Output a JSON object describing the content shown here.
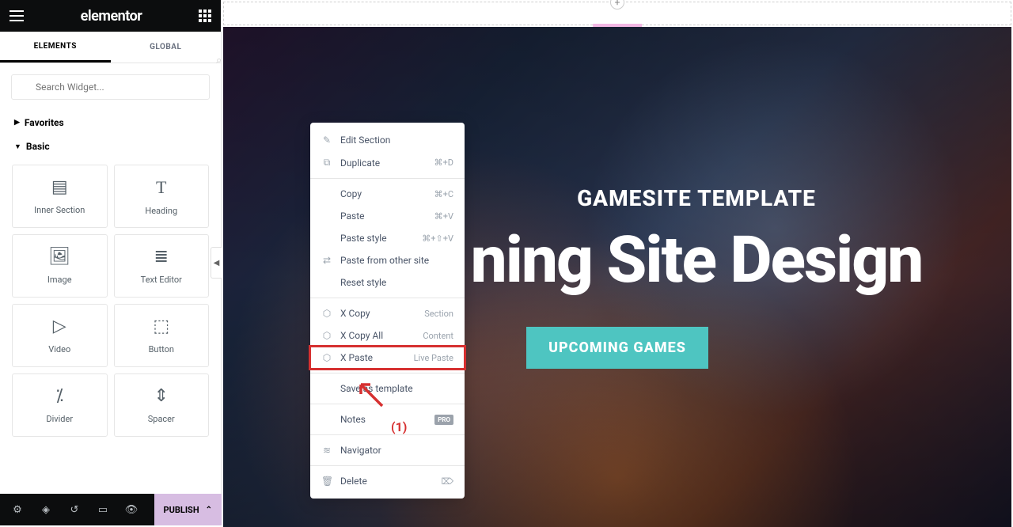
{
  "header": {
    "logo": "elementor"
  },
  "tabs": {
    "elements": "ELEMENTS",
    "global": "GLOBAL"
  },
  "search": {
    "placeholder": "Search Widget..."
  },
  "categories": {
    "favorites": "Favorites",
    "basic": "Basic"
  },
  "widgets": {
    "inner_section": "Inner Section",
    "heading": "Heading",
    "image": "Image",
    "text_editor": "Text Editor",
    "video": "Video",
    "button": "Button",
    "divider": "Divider",
    "spacer": "Spacer"
  },
  "footer": {
    "publish": "PUBLISH"
  },
  "context_menu": {
    "edit_section": "Edit Section",
    "duplicate": {
      "label": "Duplicate",
      "shortcut": "⌘+D"
    },
    "copy": {
      "label": "Copy",
      "shortcut": "⌘+C"
    },
    "paste": {
      "label": "Paste",
      "shortcut": "⌘+V"
    },
    "paste_style": {
      "label": "Paste style",
      "shortcut": "⌘+⇧+V"
    },
    "paste_from_other": "Paste from other site",
    "reset_style": "Reset style",
    "x_copy": {
      "label": "X Copy",
      "shortcut": "Section"
    },
    "x_copy_all": {
      "label": "X Copy All",
      "shortcut": "Content"
    },
    "x_paste": {
      "label": "X Paste",
      "shortcut": "Live Paste"
    },
    "save_template": "Save as template",
    "notes": {
      "label": "Notes",
      "pro": "PRO"
    },
    "navigator": "Navigator",
    "delete": "Delete"
  },
  "hero": {
    "label": "GAMESITE TEMPLATE",
    "title": "ning Site Design",
    "button": "UPCOMING GAMES"
  },
  "annotation": {
    "label": "(1)"
  }
}
